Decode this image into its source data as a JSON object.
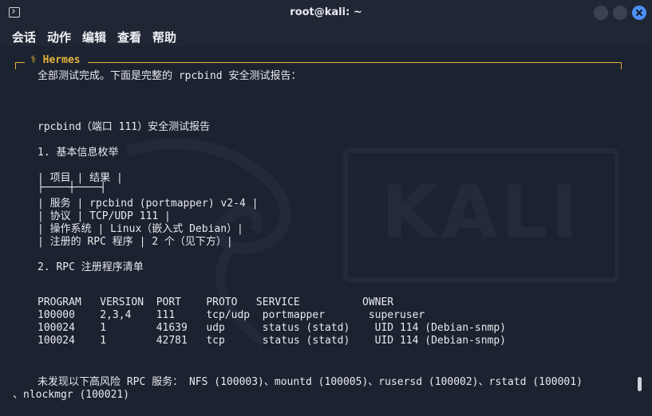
{
  "window": {
    "title": "root@kali: ~"
  },
  "menu": [
    "会话",
    "动作",
    "编辑",
    "查看",
    "帮助"
  ],
  "terminal": {
    "hermes_label": "⚕ Hermes",
    "lines": [
      "全部测试完成。下面是完整的 rpcbind 安全测试报告：",
      "rpcbind（端口 111）安全测试报告",
      "1. 基本信息枚举",
      "| 项目 | 结果 |",
      "├────┼────┤",
      "| 服务 | rpcbind (portmapper) v2-4 |",
      "| 协议 | TCP/UDP 111 |",
      "| 操作系统 | Linux（嵌入式 Debian）|",
      "| 注册的 RPC 程序 | 2 个（见下方）|",
      "2. RPC 注册程序清单",
      "PROGRAM   VERSION  PORT    PROTO   SERVICE          OWNER",
      "100000    2,3,4    111     tcp/udp  portmapper       superuser",
      "100024    1        41639   udp      status (statd)    UID 114 (Debian-snmp)",
      "100024    1        42781   tcp      status (statd)    UID 114 (Debian-snmp)",
      "未发现以下高风险 RPC 服务： NFS (100003)、mountd (100005)、rusersd (100002)、rstatd (100001)",
      "、nlockmgr (100021)"
    ]
  },
  "watermark": "KALI",
  "colors": {
    "background": "#1b2230",
    "accent": "#e3b33a",
    "text": "#e8eaed",
    "close_button": "#4d8ef2"
  }
}
